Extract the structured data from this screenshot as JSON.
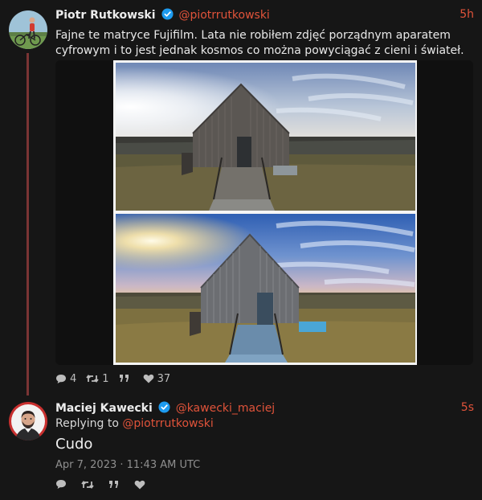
{
  "tweets": [
    {
      "author_name": "Piotr Rutkowski",
      "author_handle": "@piotrrutkowski",
      "time": "5h",
      "text": "Fajne te matryce Fujifilm. Lata nie robiłem zdjęć porządnym aparatem cyfrowym i to jest jednak kosmos co można powyciągać z cieni i świateł.",
      "stats": {
        "replies": "4",
        "retweets": "1",
        "quotes": "",
        "likes": "37"
      }
    },
    {
      "author_name": "Maciej Kawecki",
      "author_handle": "@kawecki_maciej",
      "time": "5s",
      "replying_prefix": "Replying to",
      "replying_handle": "@piotrrutkowski",
      "text": "Cudo",
      "date": "Apr 7, 2023 · 11:43 AM UTC"
    }
  ],
  "colors": {
    "accent": "#e0533a",
    "verified": "#1d9bf0",
    "thread_line": "#7a3434",
    "background": "#161616"
  },
  "icons": [
    "verified-icon",
    "reply-icon",
    "retweet-icon",
    "quote-icon",
    "heart-icon"
  ]
}
